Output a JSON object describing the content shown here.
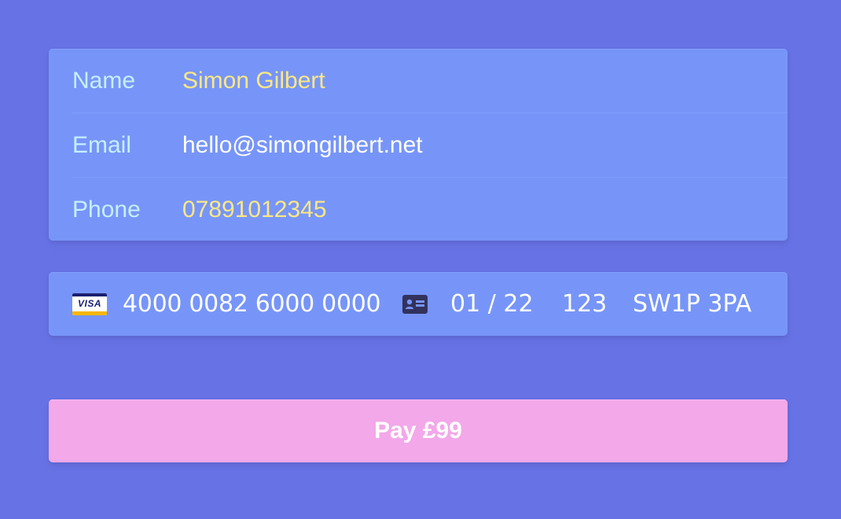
{
  "form": {
    "name": {
      "label": "Name",
      "value": "Simon Gilbert"
    },
    "email": {
      "label": "Email",
      "value": "hello@simongilbert.net"
    },
    "phone": {
      "label": "Phone",
      "value": "07891012345"
    }
  },
  "card": {
    "brand_icon": "visa-icon",
    "brand_text": "VISA",
    "number": "4000 0082 6000 0000",
    "cvc_icon": "card-id-icon",
    "expiry": "01 / 22",
    "cvc": "123",
    "postal": "SW1P 3PA"
  },
  "pay_button": {
    "label": "Pay £99"
  },
  "colors": {
    "background": "#6772e5",
    "panel": "#7795f8",
    "label": "#c4f0ff",
    "placeholder": "#fce883",
    "button": "#f3a8e9"
  }
}
